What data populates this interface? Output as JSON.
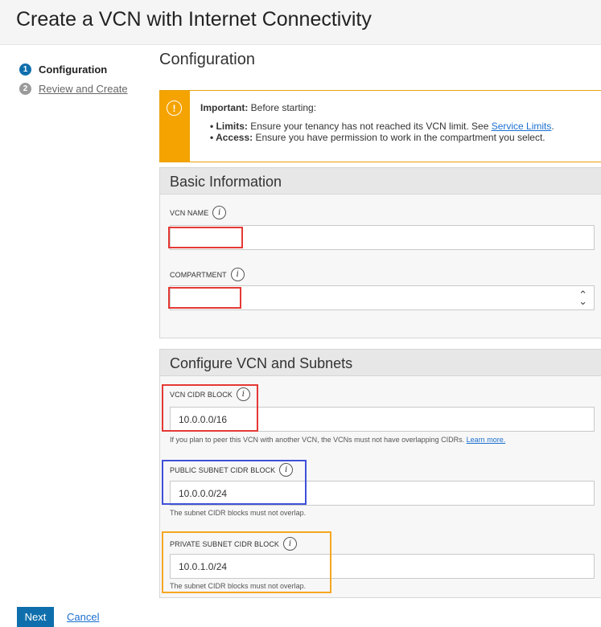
{
  "page": {
    "title": "Create a VCN with Internet Connectivity"
  },
  "steps": [
    {
      "number": "1",
      "label": "Configuration"
    },
    {
      "number": "2",
      "label": "Review and Create"
    }
  ],
  "section_title": "Configuration",
  "alert": {
    "icon": "!",
    "heading_bold": "Important:",
    "heading_rest": " Before starting:",
    "items": [
      {
        "bold": "Limits:",
        "text": " Ensure your tenancy has not reached its VCN limit. See ",
        "link": "Service Limits",
        "after": "."
      },
      {
        "bold": "Access:",
        "text": " Ensure you have permission to work in the compartment you select."
      }
    ]
  },
  "basic_info": {
    "heading": "Basic Information",
    "vcn_name_label": "VCN NAME",
    "vcn_name_value": "",
    "compartment_label": "COMPARTMENT",
    "compartment_value": ""
  },
  "vcn_subnets": {
    "heading": "Configure VCN and Subnets",
    "cidr_label": "VCN CIDR BLOCK",
    "cidr_value": "10.0.0.0/16",
    "cidr_help": "If you plan to peer this VCN with another VCN, the VCNs must not have overlapping CIDRs. ",
    "cidr_help_link": "Learn more.",
    "public_label": "PUBLIC SUBNET CIDR BLOCK",
    "public_value": "10.0.0.0/24",
    "public_help": "The subnet CIDR blocks must not overlap.",
    "private_label": "PRIVATE SUBNET CIDR BLOCK",
    "private_value": "10.0.1.0/24",
    "private_help": "The subnet CIDR blocks must not overlap."
  },
  "info_icon": "i",
  "footer": {
    "next": "Next",
    "cancel": "Cancel"
  },
  "colors": {
    "primary": "#0f6fad",
    "warning": "#f4a300",
    "highlight_red": "#e53935",
    "highlight_blue": "#3f51d8",
    "highlight_orange": "#f5a623"
  }
}
